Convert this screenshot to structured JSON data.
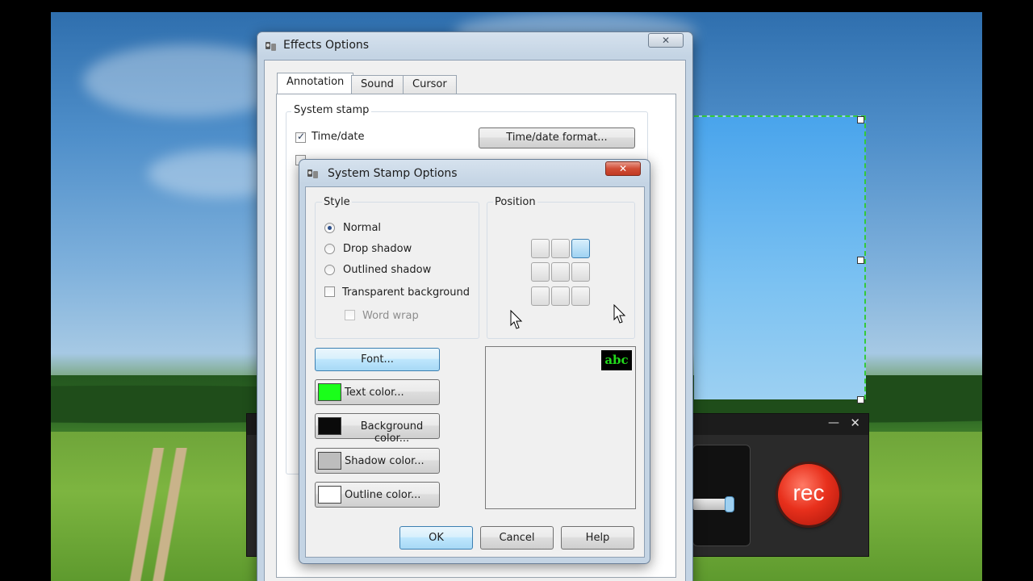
{
  "effects_dialog": {
    "title": "Effects Options",
    "close_symbol": "✕",
    "tabs": [
      {
        "label": "Annotation",
        "active": true
      },
      {
        "label": "Sound",
        "active": false
      },
      {
        "label": "Cursor",
        "active": false
      }
    ],
    "system_stamp_group": "System stamp",
    "timedate_label": "Time/date",
    "timedate_checked": true,
    "timedate_format_button": "Time/date format..."
  },
  "stamp_dialog": {
    "title": "System Stamp Options",
    "close_symbol": "✕",
    "style_group": "Style",
    "style_options": [
      {
        "label": "Normal",
        "checked": true
      },
      {
        "label": "Drop shadow",
        "checked": false
      },
      {
        "label": "Outlined shadow",
        "checked": false
      }
    ],
    "transparent_background": "Transparent background",
    "word_wrap": "Word wrap",
    "position_group": "Position",
    "selected_position": "top-right",
    "font_button": "Font...",
    "color_buttons": [
      {
        "label": "Text color...",
        "color": "#1aff1a"
      },
      {
        "label": "Background color...",
        "color": "#0a0a0a"
      },
      {
        "label": "Shadow color...",
        "color": "#bdbdbd"
      },
      {
        "label": "Outline color...",
        "color": "#ffffff"
      }
    ],
    "preview_text": "abc",
    "ok_button": "OK",
    "cancel_button": "Cancel",
    "help_button": "Help"
  },
  "recorder": {
    "rec_label": "rec",
    "minimize_symbol": "—",
    "close_symbol": "✕"
  }
}
